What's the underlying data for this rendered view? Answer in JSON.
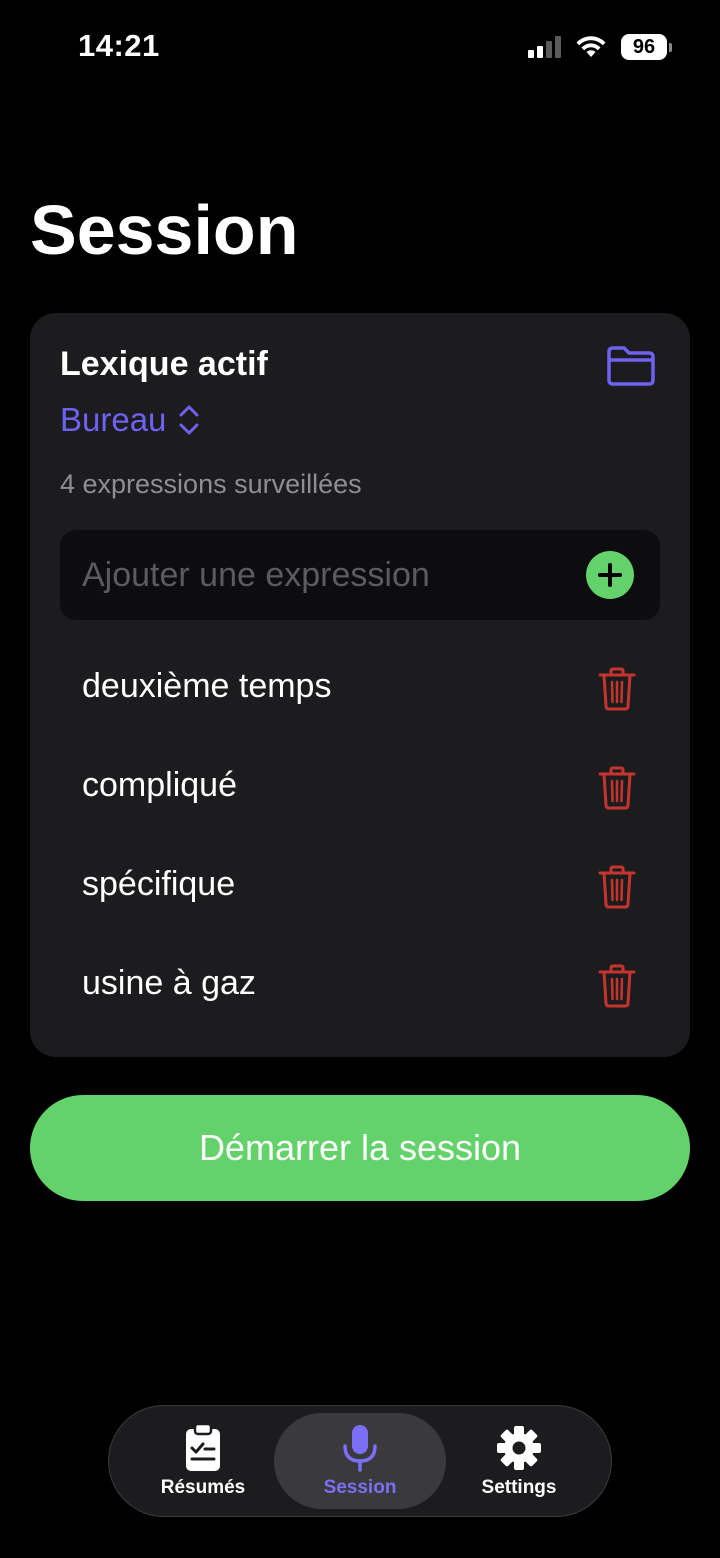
{
  "status_bar": {
    "time": "14:21",
    "battery": "96"
  },
  "page": {
    "title": "Session"
  },
  "lexicon_card": {
    "title": "Lexique actif",
    "selected_lexicon": "Bureau",
    "count_text": "4 expressions surveillées",
    "add_placeholder": "Ajouter une expression",
    "expressions": [
      {
        "label": "deuxième temps"
      },
      {
        "label": "compliqué"
      },
      {
        "label": "spécifique"
      },
      {
        "label": "usine à gaz"
      }
    ]
  },
  "start_button": {
    "label": "Démarrer la session"
  },
  "tabbar": {
    "tabs": [
      {
        "label": "Résumés",
        "icon": "clipboard-check-icon"
      },
      {
        "label": "Session",
        "icon": "microphone-icon",
        "active": true
      },
      {
        "label": "Settings",
        "icon": "gear-icon"
      }
    ]
  },
  "colors": {
    "accent": "#6e62f5",
    "green": "#63d26a",
    "danger": "#c6352d",
    "card": "#1c1c1e",
    "background": "#000000"
  }
}
